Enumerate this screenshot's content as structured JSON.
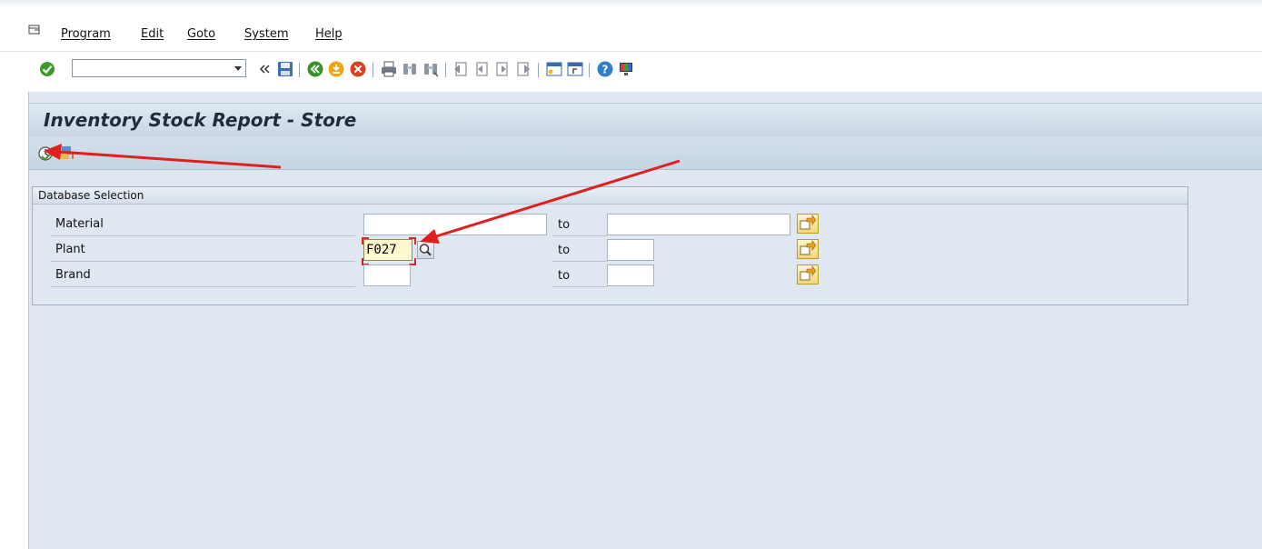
{
  "menu": {
    "items": [
      {
        "label": "Program"
      },
      {
        "label": "Edit"
      },
      {
        "label": "Goto"
      },
      {
        "label": "System"
      },
      {
        "label": "Help"
      }
    ]
  },
  "toolbar": {
    "command_field": {
      "value": "",
      "placeholder": ""
    },
    "icons": [
      "enter-icon",
      "back-arrows-icon",
      "save-icon",
      "back-icon",
      "exit-icon",
      "cancel-icon",
      "print-icon",
      "find-icon",
      "find-next-icon",
      "first-page-icon",
      "previous-page-icon",
      "next-page-icon",
      "last-page-icon",
      "create-session-icon",
      "shortcut-icon",
      "help-icon",
      "customize-layout-icon"
    ]
  },
  "screen": {
    "title": "Inventory Stock Report - Store",
    "app_toolbar_icons": [
      "execute-icon",
      "get-variant-icon"
    ]
  },
  "group": {
    "title": "Database Selection",
    "to_label": "to",
    "rows": [
      {
        "label": "Material",
        "low": "",
        "high": ""
      },
      {
        "label": "Plant",
        "low": "F027",
        "high": ""
      },
      {
        "label": "Brand",
        "low": "",
        "high": ""
      }
    ]
  },
  "colors": {
    "screen_bg": "#dfe8f1",
    "active_field": "#fff7cf",
    "annotation_arrow": "#e02020"
  }
}
